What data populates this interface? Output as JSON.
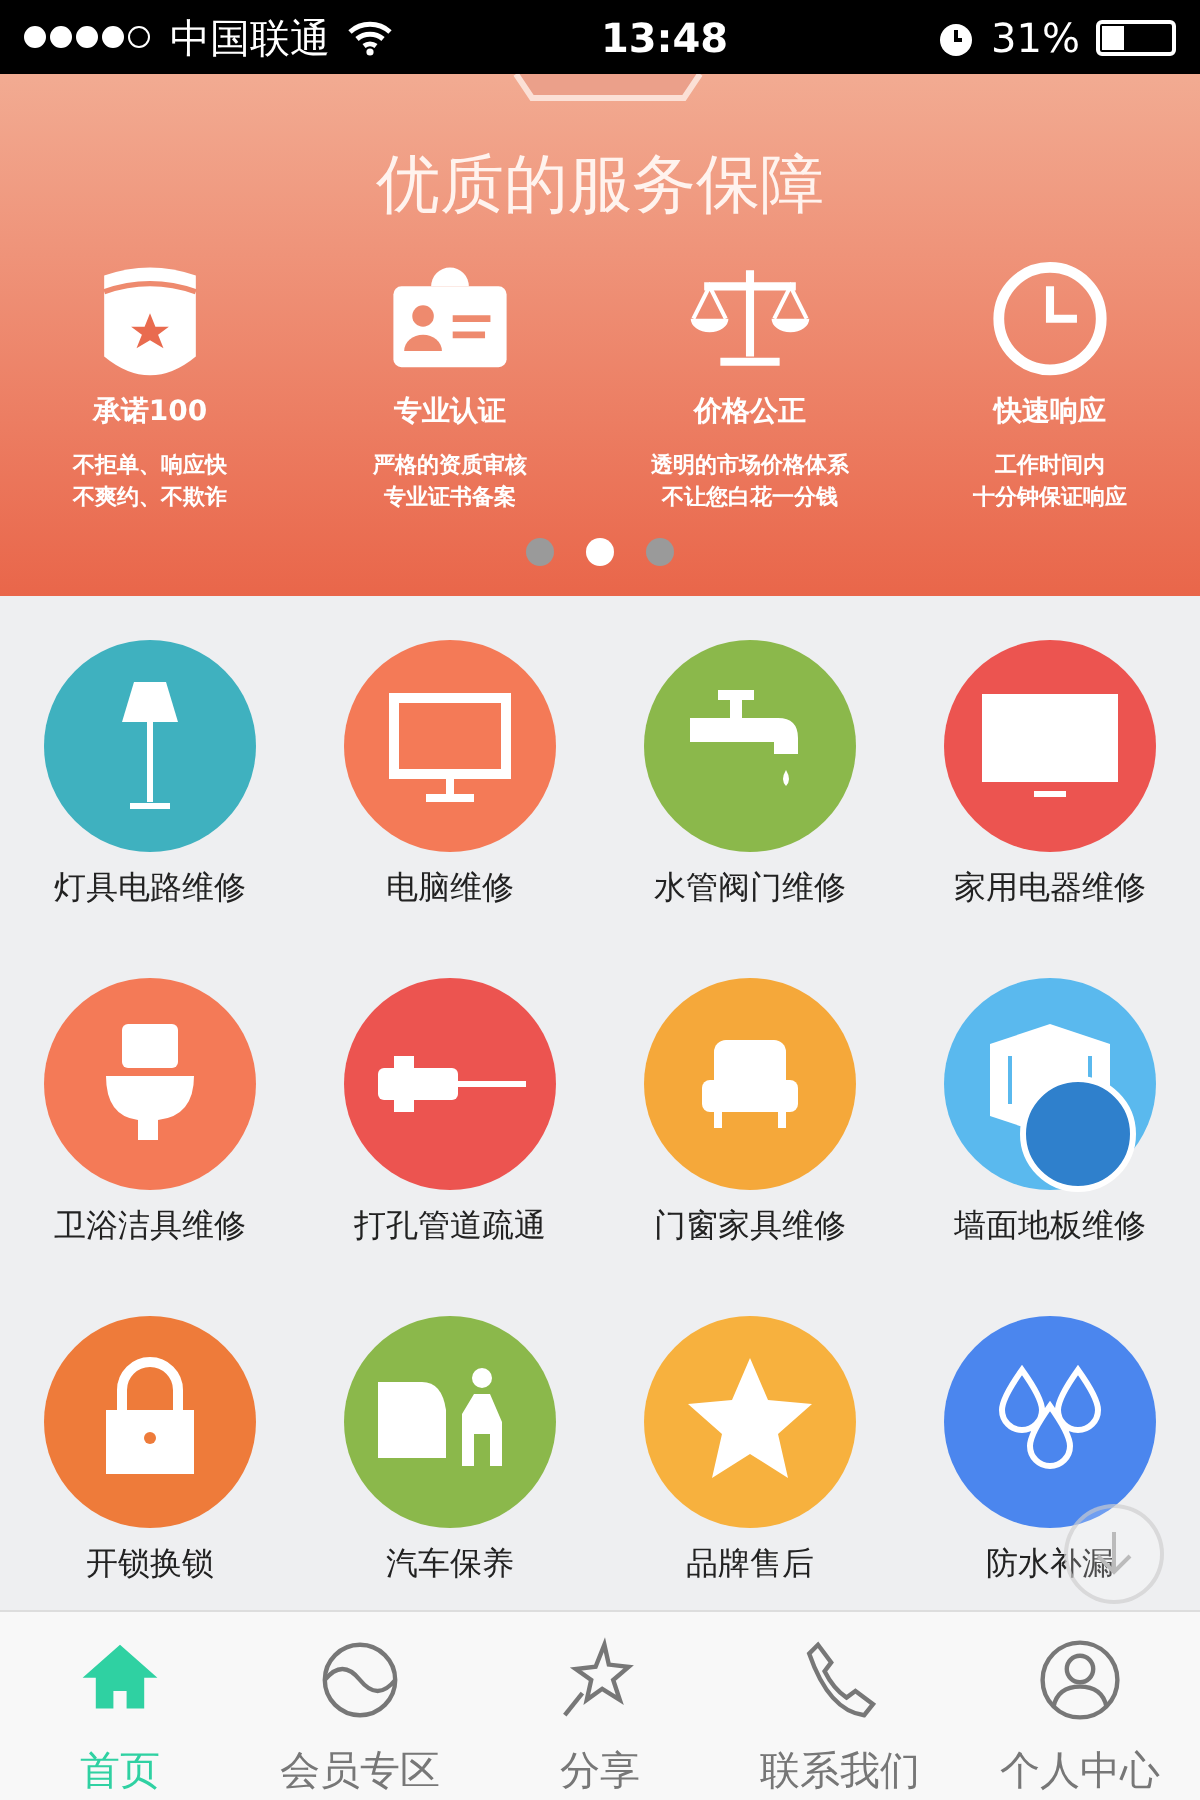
{
  "status_bar": {
    "signal_dots": [
      {
        "on": true
      },
      {
        "on": true
      },
      {
        "on": true
      },
      {
        "on": true
      },
      {
        "on": false
      }
    ],
    "carrier": "中国联通",
    "time": "13:48",
    "battery_text": "31%"
  },
  "banner": {
    "title": "优质的服务保障",
    "features": [
      {
        "kind": "shield",
        "title": "承诺100",
        "lines": [
          "不拒单、响应快",
          "不爽约、不欺诈"
        ]
      },
      {
        "kind": "badge",
        "title": "专业认证",
        "lines": [
          "严格的资质审核",
          "专业证书备案"
        ]
      },
      {
        "kind": "scale",
        "title": "价格公正",
        "lines": [
          "透明的市场价格体系",
          "不让您白花一分钱"
        ]
      },
      {
        "kind": "clock",
        "title": "快速响应",
        "lines": [
          "工作时间内",
          "十分钟保证响应"
        ]
      }
    ],
    "dots": [
      {
        "selected": false
      },
      {
        "selected": true
      },
      {
        "selected": false
      }
    ]
  },
  "services": [
    {
      "kind": "lamp",
      "label": "灯具电路维修",
      "color": "#3fb1bf"
    },
    {
      "kind": "monitor",
      "label": "电脑维修",
      "color": "#f47a57"
    },
    {
      "kind": "faucet",
      "label": "水管阀门维修",
      "color": "#8bb84b"
    },
    {
      "kind": "tv",
      "label": "家用电器维修",
      "color": "#ec5450"
    },
    {
      "kind": "toilet",
      "label": "卫浴洁具维修",
      "color": "#f47a57"
    },
    {
      "kind": "drill",
      "label": "打孔管道疏通",
      "color": "#ec5450"
    },
    {
      "kind": "sofa",
      "label": "门窗家具维修",
      "color": "#f5a83a"
    },
    {
      "kind": "wall",
      "label": "墙面地板维修",
      "color": "#5ab9ee"
    },
    {
      "kind": "lock",
      "label": "开锁换锁",
      "color": "#ee7b3a"
    },
    {
      "kind": "car",
      "label": "汽车保养",
      "color": "#8bb84b"
    },
    {
      "kind": "star",
      "label": "品牌售后",
      "color": "#f7b13e"
    },
    {
      "kind": "drops",
      "label": "防水补漏",
      "color": "#4b86ee"
    }
  ],
  "tabs": [
    {
      "kind": "home",
      "label": "首页",
      "selected": true
    },
    {
      "kind": "vip",
      "label": "会员专区",
      "selected": false
    },
    {
      "kind": "share",
      "label": "分享",
      "selected": false
    },
    {
      "kind": "phone",
      "label": "联系我们",
      "selected": false
    },
    {
      "kind": "user",
      "label": "个人中心",
      "selected": false
    }
  ]
}
